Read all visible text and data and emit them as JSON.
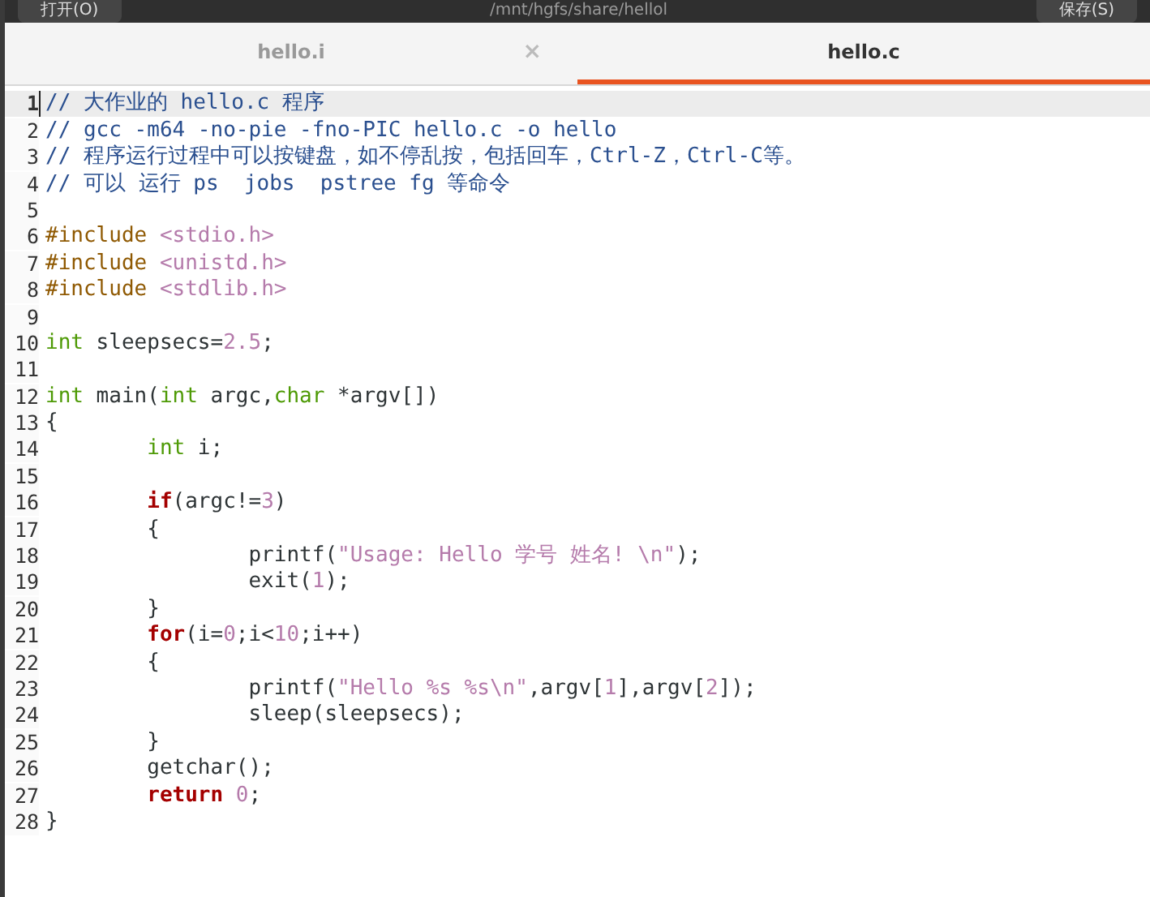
{
  "header": {
    "buttons": [
      {
        "label": "打开(O)"
      },
      {
        "label": "保存(S)"
      }
    ],
    "path": "/mnt/hgfs/share/hellol"
  },
  "tabs": [
    {
      "label": "hello.i",
      "selected": false,
      "close": "×"
    },
    {
      "label": "hello.c",
      "selected": true
    }
  ],
  "editor": {
    "lines": [
      {
        "number": "1",
        "current": true,
        "tokens": [
          {
            "kind": "comment",
            "text": "// 大作业的 hello.c 程序"
          }
        ]
      },
      {
        "number": "2",
        "current": false,
        "tokens": [
          {
            "kind": "comment",
            "text": "// gcc -m64 -no-pie -fno-PIC hello.c -o hello"
          }
        ]
      },
      {
        "number": "3",
        "current": false,
        "tokens": [
          {
            "kind": "comment",
            "text": "// 程序运行过程中可以按键盘，如不停乱按，包括回车，Ctrl-Z，Ctrl-C等。"
          }
        ]
      },
      {
        "number": "4",
        "current": false,
        "tokens": [
          {
            "kind": "comment",
            "text": "// 可以 运行 ps  jobs  pstree fg 等命令"
          }
        ]
      },
      {
        "number": "5",
        "current": false
      },
      {
        "number": "6",
        "current": false,
        "tokens": [
          {
            "kind": "preproc",
            "text": "#include "
          },
          {
            "kind": "string",
            "text": "<stdio.h>"
          }
        ]
      },
      {
        "number": "7",
        "current": false,
        "tokens": [
          {
            "kind": "preproc",
            "text": "#include "
          },
          {
            "kind": "string",
            "text": "<unistd.h>"
          }
        ]
      },
      {
        "number": "8",
        "current": false,
        "tokens": [
          {
            "kind": "preproc",
            "text": "#include "
          },
          {
            "kind": "string",
            "text": "<stdlib.h>"
          }
        ]
      },
      {
        "number": "9",
        "current": false
      },
      {
        "number": "10",
        "current": false,
        "tokens": [
          {
            "kind": "type",
            "text": "int"
          },
          {
            "kind": "plain",
            "text": " sleepsecs="
          },
          {
            "kind": "number",
            "text": "2.5"
          },
          {
            "kind": "plain",
            "text": ";"
          }
        ]
      },
      {
        "number": "11",
        "current": false
      },
      {
        "number": "12",
        "current": false,
        "tokens": [
          {
            "kind": "type",
            "text": "int"
          },
          {
            "kind": "plain",
            "text": " main("
          },
          {
            "kind": "type",
            "text": "int"
          },
          {
            "kind": "plain",
            "text": " argc,"
          },
          {
            "kind": "type",
            "text": "char"
          },
          {
            "kind": "plain",
            "text": " *argv[])"
          }
        ]
      },
      {
        "number": "13",
        "current": false,
        "tokens": [
          {
            "kind": "plain",
            "text": "{"
          }
        ]
      },
      {
        "number": "14",
        "current": false,
        "tokens": [
          {
            "kind": "type",
            "text": "\tint"
          },
          {
            "kind": "plain",
            "text": " i;"
          }
        ]
      },
      {
        "number": "15",
        "current": false
      },
      {
        "number": "16",
        "current": false,
        "tokens": [
          {
            "kind": "keyword",
            "text": "\tif"
          },
          {
            "kind": "plain",
            "text": "(argc!="
          },
          {
            "kind": "number",
            "text": "3"
          },
          {
            "kind": "plain",
            "text": ")"
          }
        ]
      },
      {
        "number": "17",
        "current": false,
        "tokens": [
          {
            "kind": "plain",
            "text": "\t{"
          }
        ]
      },
      {
        "number": "18",
        "current": false,
        "tokens": [
          {
            "kind": "plain",
            "text": "\t\tprintf("
          },
          {
            "kind": "string",
            "text": "\"Usage: Hello 学号 姓名! \\n\""
          },
          {
            "kind": "plain",
            "text": ");"
          }
        ]
      },
      {
        "number": "19",
        "current": false,
        "tokens": [
          {
            "kind": "plain",
            "text": "\t\texit("
          },
          {
            "kind": "number",
            "text": "1"
          },
          {
            "kind": "plain",
            "text": ");"
          }
        ]
      },
      {
        "number": "20",
        "current": false,
        "tokens": [
          {
            "kind": "plain",
            "text": "\t}"
          }
        ]
      },
      {
        "number": "21",
        "current": false,
        "tokens": [
          {
            "kind": "keyword",
            "text": "\tfor"
          },
          {
            "kind": "plain",
            "text": "(i="
          },
          {
            "kind": "number",
            "text": "0"
          },
          {
            "kind": "plain",
            "text": ";i<"
          },
          {
            "kind": "number",
            "text": "10"
          },
          {
            "kind": "plain",
            "text": ";i++)"
          }
        ]
      },
      {
        "number": "22",
        "current": false,
        "tokens": [
          {
            "kind": "plain",
            "text": "\t{"
          }
        ]
      },
      {
        "number": "23",
        "current": false,
        "tokens": [
          {
            "kind": "plain",
            "text": "\t\tprintf("
          },
          {
            "kind": "string",
            "text": "\"Hello %s %s\\n\""
          },
          {
            "kind": "plain",
            "text": ",argv["
          },
          {
            "kind": "number",
            "text": "1"
          },
          {
            "kind": "plain",
            "text": "],argv["
          },
          {
            "kind": "number",
            "text": "2"
          },
          {
            "kind": "plain",
            "text": "]);"
          }
        ]
      },
      {
        "number": "24",
        "current": false,
        "tokens": [
          {
            "kind": "plain",
            "text": "\t\tsleep(sleepsecs);"
          }
        ]
      },
      {
        "number": "25",
        "current": false,
        "tokens": [
          {
            "kind": "plain",
            "text": "\t}"
          }
        ]
      },
      {
        "number": "26",
        "current": false,
        "tokens": [
          {
            "kind": "plain",
            "text": "\tgetchar();"
          }
        ]
      },
      {
        "number": "27",
        "current": false,
        "tokens": [
          {
            "kind": "keyword",
            "text": "\treturn "
          },
          {
            "kind": "number",
            "text": "0"
          },
          {
            "kind": "plain",
            "text": ";"
          }
        ]
      },
      {
        "number": "28",
        "current": false,
        "tokens": [
          {
            "kind": "plain",
            "text": "}"
          }
        ]
      }
    ]
  }
}
